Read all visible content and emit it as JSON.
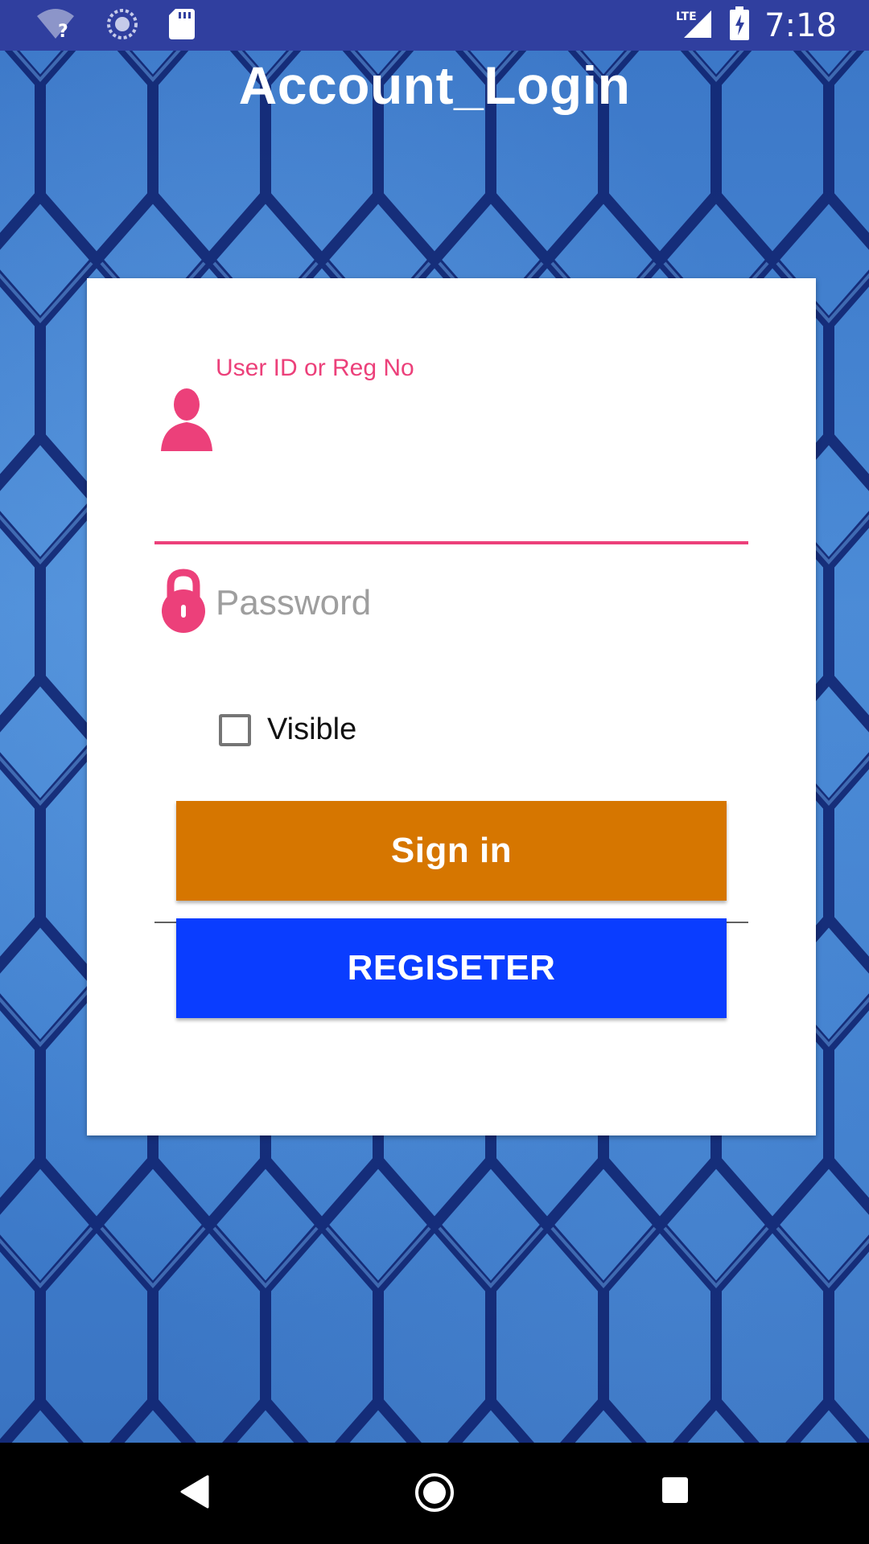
{
  "status_bar": {
    "time": "7:18",
    "network": "LTE",
    "icons": [
      "wifi-question-icon",
      "sync-icon",
      "sd-card-icon",
      "lte-signal-icon",
      "battery-charging-icon"
    ]
  },
  "app": {
    "title": "Account_Login"
  },
  "form": {
    "user_id_label": "User ID or Reg No",
    "user_id_value": "",
    "password_placeholder": "Password",
    "password_value": "",
    "visible_label": "Visible",
    "visible_checked": false,
    "signin_label": "Sign in",
    "register_label": "REGISETER"
  },
  "colors": {
    "status_bar": "#303f9f",
    "accent": "#ec407a",
    "signin_button": "#d67600",
    "register_button": "#0a3dff"
  },
  "nav_bar": {
    "icons": [
      "back-icon",
      "home-icon",
      "recents-icon"
    ]
  }
}
